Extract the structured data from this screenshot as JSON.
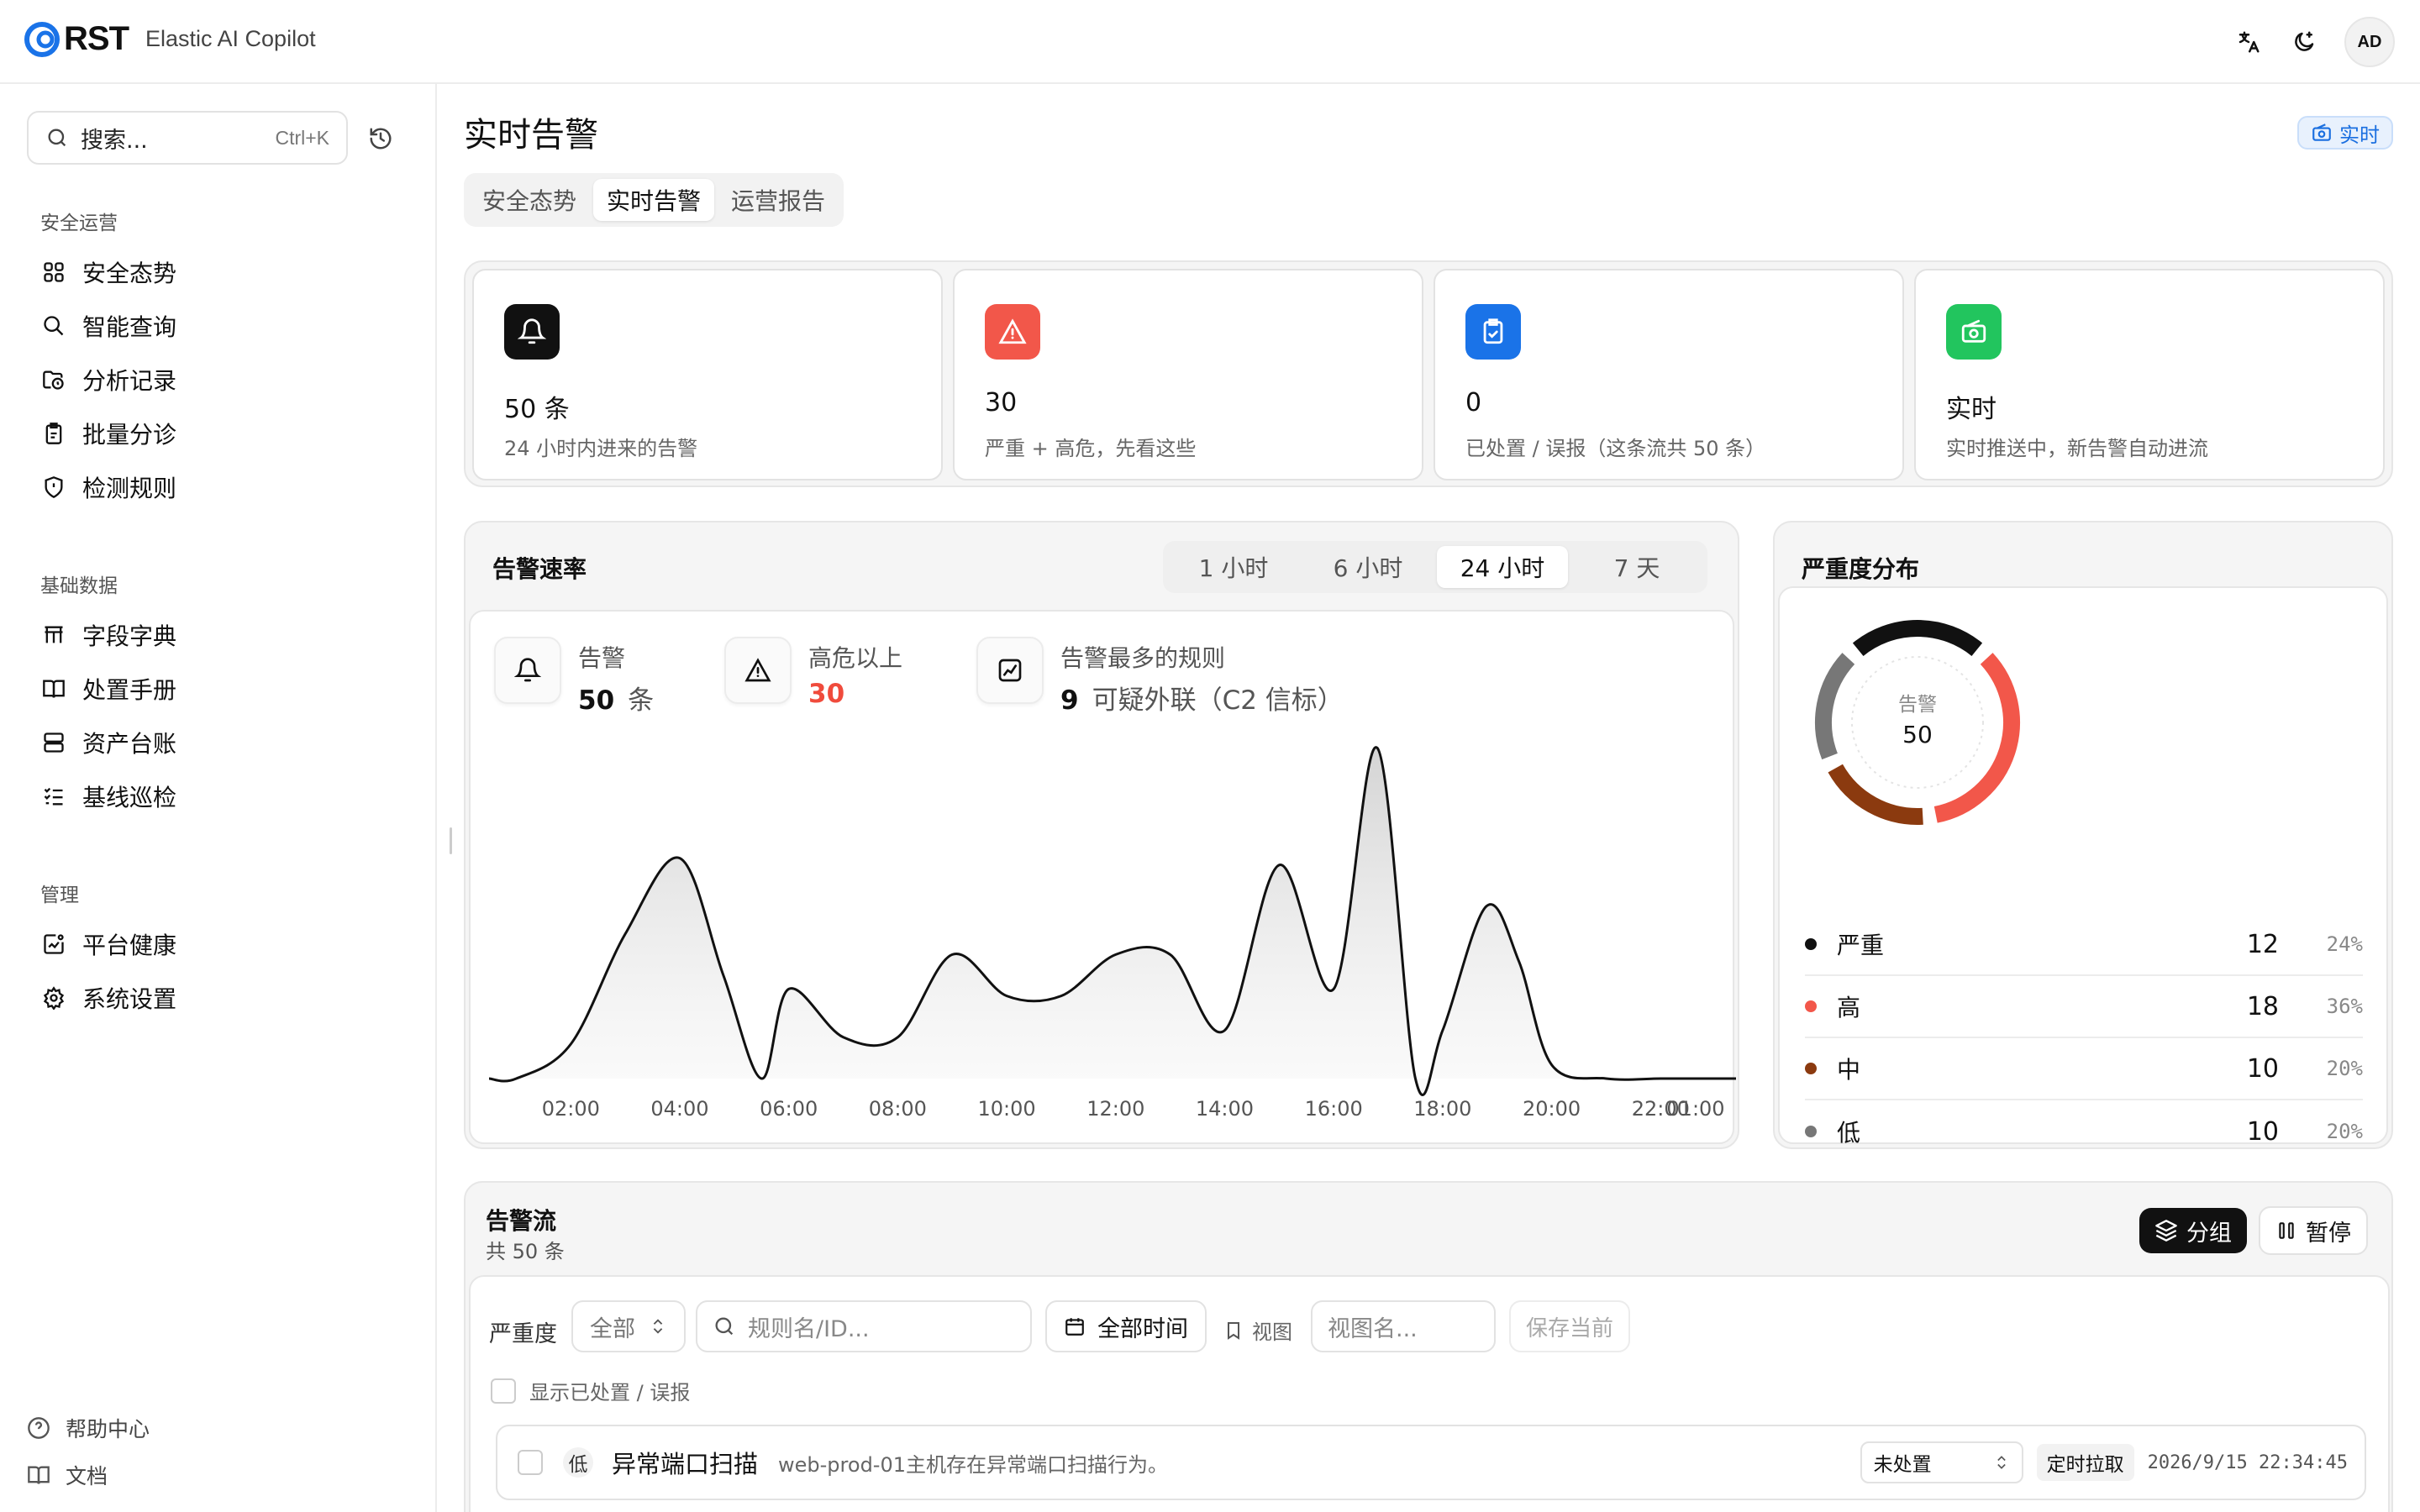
{
  "app": {
    "logo_text": "RST",
    "subtitle": "Elastic AI Copilot",
    "avatar": "AD"
  },
  "sidebar": {
    "search_placeholder": "搜索...",
    "search_shortcut": "Ctrl+K",
    "sections": [
      {
        "label": "安全运营",
        "items": [
          "安全态势",
          "智能查询",
          "分析记录",
          "批量分诊",
          "检测规则"
        ]
      },
      {
        "label": "基础数据",
        "items": [
          "字段字典",
          "处置手册",
          "资产台账",
          "基线巡检"
        ]
      },
      {
        "label": "管理",
        "items": [
          "平台健康",
          "系统设置"
        ]
      }
    ],
    "footer": [
      "帮助中心",
      "文档"
    ]
  },
  "page": {
    "title": "实时告警",
    "live_badge": "实时",
    "tabs": [
      "安全态势",
      "实时告警",
      "运营报告"
    ],
    "active_tab": "实时告警"
  },
  "stats": [
    {
      "value": "50 条",
      "desc": "24 小时内进来的告警",
      "icon": "bell-icon",
      "color": "#111111"
    },
    {
      "value": "30",
      "desc": "严重 + 高危，先看这些",
      "icon": "warning-icon",
      "color": "#f2574a"
    },
    {
      "value": "0",
      "desc": "已处置 / 误报（这条流共 50 条）",
      "icon": "clipboard-check-icon",
      "color": "#1a73e8"
    },
    {
      "value": "实时",
      "desc": "实时推送中，新告警自动进流",
      "icon": "radio-icon",
      "color": "#22c55e"
    }
  ],
  "rate": {
    "title": "告警速率",
    "ranges": [
      "1 小时",
      "6 小时",
      "24 小时",
      "7 天"
    ],
    "active_range": "24 小时",
    "kpis": {
      "alerts": {
        "label": "告警",
        "value": "50",
        "unit": "条"
      },
      "high": {
        "label": "高危以上",
        "value": "30"
      },
      "top_rule": {
        "label": "告警最多的规则",
        "value": "9",
        "name": "可疑外联（C2 信标）"
      }
    }
  },
  "chart_data": {
    "type": "area",
    "title": "告警速率",
    "x_labels": [
      "02:00",
      "04:00",
      "06:00",
      "08:00",
      "10:00",
      "12:00",
      "14:00",
      "16:00",
      "18:00",
      "20:00",
      "22:00",
      "01:00"
    ],
    "x": [
      1.0,
      2.0,
      3.0,
      4.0,
      4.8,
      5.5,
      6.0,
      7.0,
      8.0,
      9.0,
      10.0,
      11.0,
      12.0,
      13.0,
      14.0,
      15.0,
      16.0,
      16.8,
      17.5,
      18.0,
      18.8,
      19.4,
      20.0,
      21.0,
      22.0,
      22.8,
      24.0
    ],
    "values": [
      0,
      0.5,
      2.1,
      3.2,
      1.5,
      0,
      1.3,
      0.6,
      0.6,
      1.8,
      1.2,
      1.2,
      1.8,
      1.8,
      0.7,
      3.1,
      1.3,
      4.8,
      0,
      0.7,
      2.5,
      1.7,
      0.2,
      0,
      0,
      0,
      0
    ],
    "grid": false
  },
  "severity": {
    "title": "严重度分布",
    "center_label": "告警",
    "center_value": "50",
    "items": [
      {
        "name": "严重",
        "count": 12,
        "pct": "24%",
        "color": "#111111"
      },
      {
        "name": "高",
        "count": 18,
        "pct": "36%",
        "color": "#f2574a"
      },
      {
        "name": "中",
        "count": 10,
        "pct": "20%",
        "color": "#8b3a0f"
      },
      {
        "name": "低",
        "count": 10,
        "pct": "20%",
        "color": "#777777"
      }
    ]
  },
  "stream": {
    "title": "告警流",
    "count": "共 50 条",
    "group_btn": "分组",
    "pause_btn": "暂停",
    "filter_label": "严重度",
    "severity_value": "全部",
    "rule_placeholder": "规则名/ID...",
    "time_btn": "全部时间",
    "view_label": "视图",
    "view_placeholder": "视图名...",
    "save_btn": "保存当前",
    "show_handled": "显示已处置 / 误报",
    "rows": [
      {
        "sev": "低",
        "rule": "异常端口扫描",
        "desc": "web-prod-01主机存在异常端口扫描行为。",
        "status": "未处置",
        "source": "定时拉取",
        "time": "2026/9/15 22:34:45"
      }
    ]
  }
}
